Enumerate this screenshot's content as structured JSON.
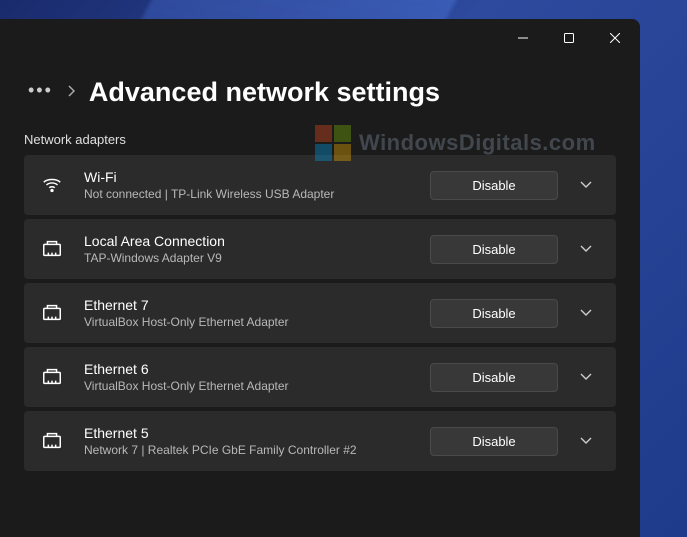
{
  "header": {
    "title": "Advanced network settings"
  },
  "section": {
    "label": "Network adapters"
  },
  "adapters": [
    {
      "name": "Wi-Fi",
      "desc": "Not connected | TP-Link Wireless USB Adapter",
      "button": "Disable",
      "icon": "wifi"
    },
    {
      "name": "Local Area Connection",
      "desc": "TAP-Windows Adapter V9",
      "button": "Disable",
      "icon": "ethernet"
    },
    {
      "name": "Ethernet 7",
      "desc": "VirtualBox Host-Only Ethernet Adapter",
      "button": "Disable",
      "icon": "ethernet"
    },
    {
      "name": "Ethernet 6",
      "desc": "VirtualBox Host-Only Ethernet Adapter",
      "button": "Disable",
      "icon": "ethernet"
    },
    {
      "name": "Ethernet 5",
      "desc": "Network 7 | Realtek PCIe GbE Family Controller #2",
      "button": "Disable",
      "icon": "ethernet"
    }
  ],
  "watermark": {
    "text": "WindowsDigitals.com"
  }
}
